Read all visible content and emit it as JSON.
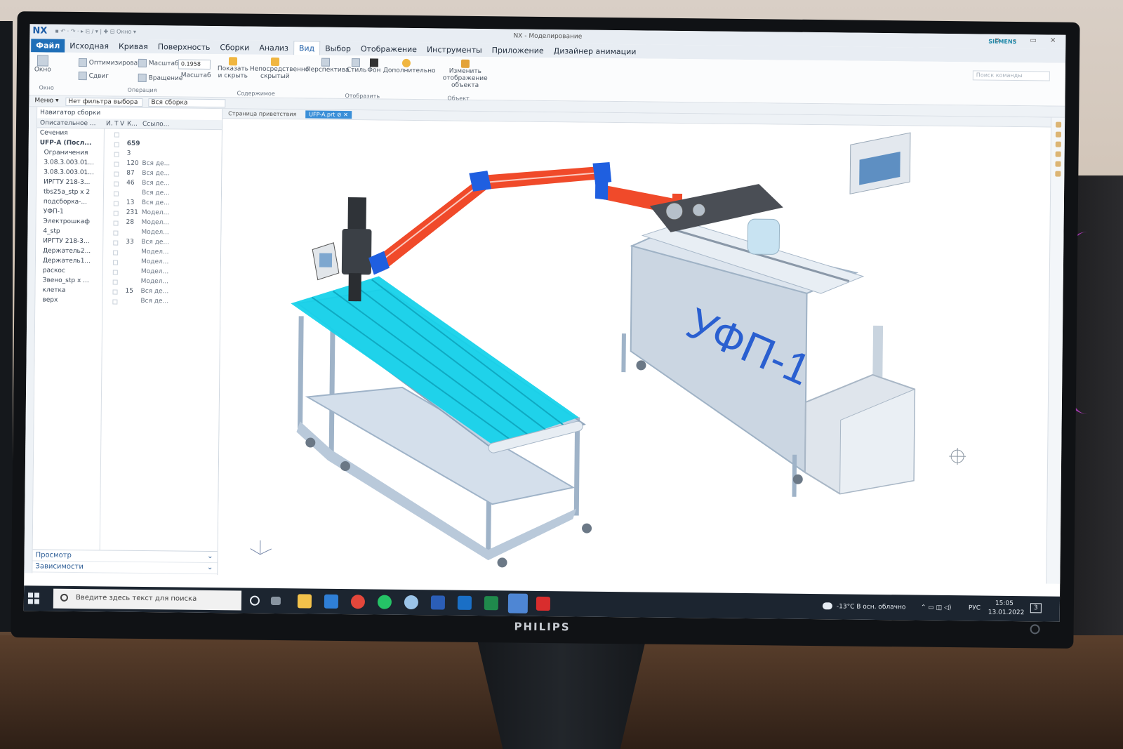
{
  "app": {
    "logo": "NX",
    "quick_access": "▪ ↶ · ↷ · ▸ ⎘ ∕ ▾ | ✚ ⊟ Окно ▾",
    "window_title": "NX - Моделирование",
    "vendor": "SIEMENS",
    "window_controls": "▫ – ▭ ✕"
  },
  "ribbon_tabs": [
    {
      "label": "Файл"
    },
    {
      "label": "Исходная"
    },
    {
      "label": "Кривая"
    },
    {
      "label": "Поверхность"
    },
    {
      "label": "Сборки"
    },
    {
      "label": "Анализ"
    },
    {
      "label": "Вид"
    },
    {
      "label": "Выбор"
    },
    {
      "label": "Отображение"
    },
    {
      "label": "Инструменты"
    },
    {
      "label": "Приложение"
    },
    {
      "label": "Дизайнер анимации"
    }
  ],
  "ribbon": {
    "window_btn": "Окно",
    "optimize_btn": "Оптимизировать",
    "scale_btn": "Масштаб",
    "zoom_value": "0.1958",
    "pan_btn": "Сдвиг",
    "rotate_btn": "Вращение",
    "scale_label": "Масштаб",
    "show_hide_btn": "Показать и скрыть",
    "immediate_hide_btn": "Непосредственно скрытый",
    "perspective_btn": "Перспектива",
    "style_btn": "Стиль",
    "background_btn": "Фон",
    "more_btn": "Дополнительно",
    "edit_display_btn": "Изменить отображение объекта",
    "search_placeholder": "Поиск команды",
    "groups": {
      "window": "Окно",
      "operation": "Операция",
      "content": "Содержимое",
      "display": "Отобразить",
      "object": "Объект"
    }
  },
  "filter_bar": {
    "menu": "Меню ▾",
    "selection_filter": "Нет фильтра выбора",
    "scope": "Вся сборка"
  },
  "navigator": {
    "title": "Навигатор сборки",
    "columns": {
      "name": "Описательное ...",
      "i": "И.",
      "t": "Т",
      "v": "V",
      "k": "К...",
      "ref": "Ссыло..."
    },
    "rows": [
      {
        "name": "Сечения",
        "count": "",
        "ref": ""
      },
      {
        "name": "UFP-A (Посл...",
        "count": "659",
        "ref": ""
      },
      {
        "name": "Ограничения",
        "count": "3",
        "ref": ""
      },
      {
        "name": "3.08.3.003.01...",
        "count": "120",
        "ref": "Вся де..."
      },
      {
        "name": "3.08.3.003.01...",
        "count": "87",
        "ref": "Вся де..."
      },
      {
        "name": "ИРГТУ 218-3...",
        "count": "46",
        "ref": "Вся де..."
      },
      {
        "name": "tbs25a_stp x 2",
        "count": "",
        "ref": "Вся де..."
      },
      {
        "name": "подсборка-...",
        "count": "13",
        "ref": "Вся де..."
      },
      {
        "name": "УФП-1",
        "count": "231",
        "ref": "Модел..."
      },
      {
        "name": "Электрошкаф",
        "count": "28",
        "ref": "Модел..."
      },
      {
        "name": "4_stp",
        "count": "",
        "ref": "Модел..."
      },
      {
        "name": "ИРГТУ 218-3...",
        "count": "33",
        "ref": "Вся де..."
      },
      {
        "name": "Держатель2...",
        "count": "",
        "ref": "Модел..."
      },
      {
        "name": "Держатель1...",
        "count": "",
        "ref": "Модел..."
      },
      {
        "name": "раскос",
        "count": "",
        "ref": "Модел..."
      },
      {
        "name": "Звено_stp x ...",
        "count": "",
        "ref": "Модел..."
      },
      {
        "name": "клетка",
        "count": "15",
        "ref": "Вся де..."
      },
      {
        "name": "верх",
        "count": "",
        "ref": "Вся де..."
      }
    ],
    "footer": {
      "preview": "Просмотр",
      "dependencies": "Зависимости"
    }
  },
  "doc_tabs": [
    {
      "label": "Страница приветствия"
    },
    {
      "label": "UFP-A.prt ⊘ ✕"
    }
  ],
  "model": {
    "machine_label": "УФП-1"
  },
  "taskbar": {
    "search_text": "Введите здесь текст для поиска",
    "weather": "-13°C  В осн. облачно",
    "lang": "РУС",
    "time": "15:05",
    "date": "13.01.2022",
    "notifications": "3"
  },
  "monitor": {
    "brand": "PHILIPS"
  },
  "colors": {
    "nx_blue": "#1f6fb8",
    "arm_red": "#f04a2a",
    "arm_joint_blue": "#1f5fe0",
    "table_cyan": "#16d2ea",
    "taskbar": "#1c2530"
  }
}
